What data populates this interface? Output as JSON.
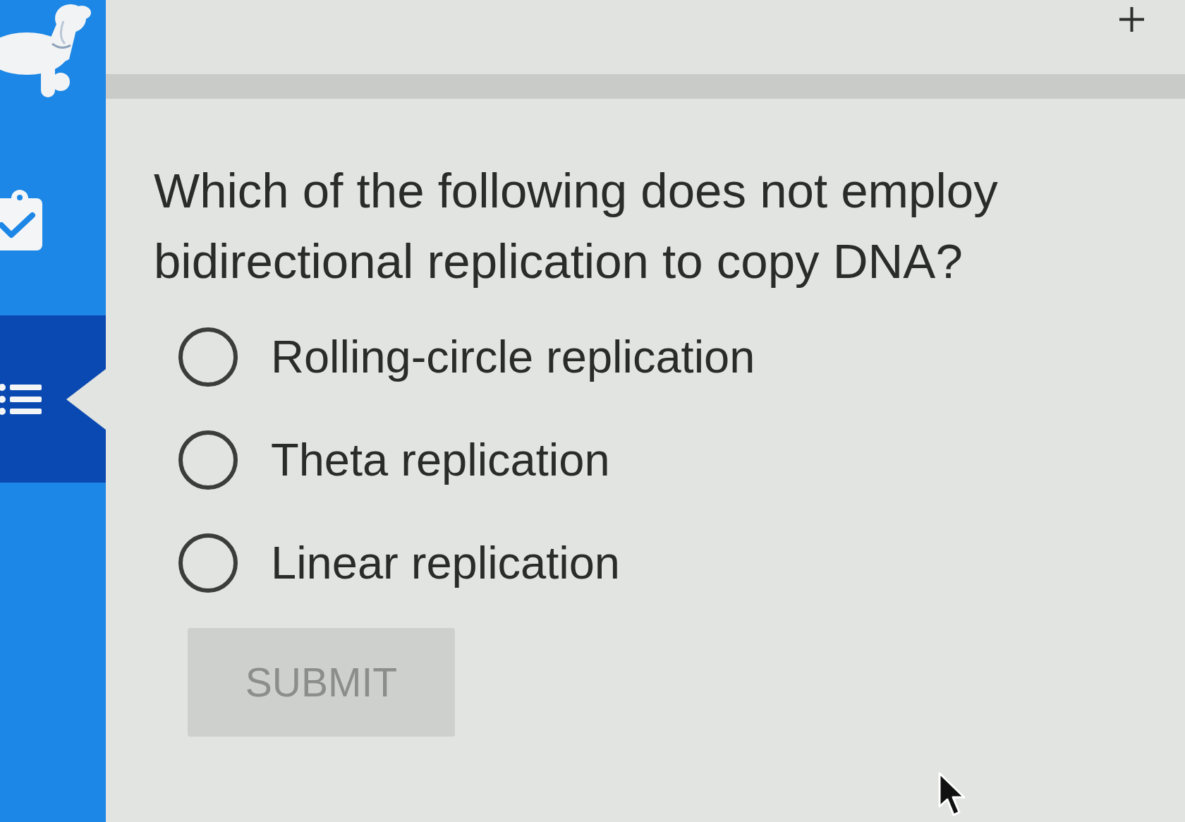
{
  "sidebar": {
    "items": [
      {
        "kind": "assignment",
        "selected": false
      },
      {
        "kind": "outline",
        "selected": true
      }
    ]
  },
  "question": {
    "prompt": "Which of the following does not employ bidirectional replication to copy DNA?",
    "options": [
      {
        "label": "Rolling-circle replication",
        "selected": false
      },
      {
        "label": "Theta replication",
        "selected": false
      },
      {
        "label": "Linear replication",
        "selected": false
      }
    ]
  },
  "submit": {
    "label": "SUBMIT",
    "disabled": true
  }
}
